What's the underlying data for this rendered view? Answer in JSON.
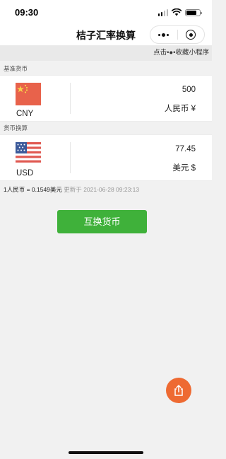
{
  "status_bar": {
    "time": "09:30",
    "battery_level": 0.75
  },
  "nav": {
    "title": "桔子汇率换算"
  },
  "favorite_hint": "点击•●•收藏小程序",
  "base_section": {
    "label": "基准货币",
    "currency_code": "CNY",
    "amount": "500",
    "currency_name": "人民币 ¥",
    "flag_icon": "china-flag-icon"
  },
  "target_section": {
    "label": "货币换算",
    "currency_code": "USD",
    "amount": "77.45",
    "currency_name": "美元 $",
    "flag_icon": "usa-flag-icon"
  },
  "rate": {
    "text": "1人民币 = 0.1549美元",
    "updated_label": "更新于",
    "updated_time": "2021-06-28 09:23:13"
  },
  "swap_button_label": "互换货币",
  "colors": {
    "accent_green": "#3fb13a",
    "share_orange": "#ee6a32",
    "background": "#f1f1f1"
  },
  "icons": [
    "signal-icon",
    "wifi-icon",
    "battery-icon",
    "more-icon",
    "close-target-icon",
    "china-flag-icon",
    "usa-flag-icon",
    "share-icon"
  ]
}
